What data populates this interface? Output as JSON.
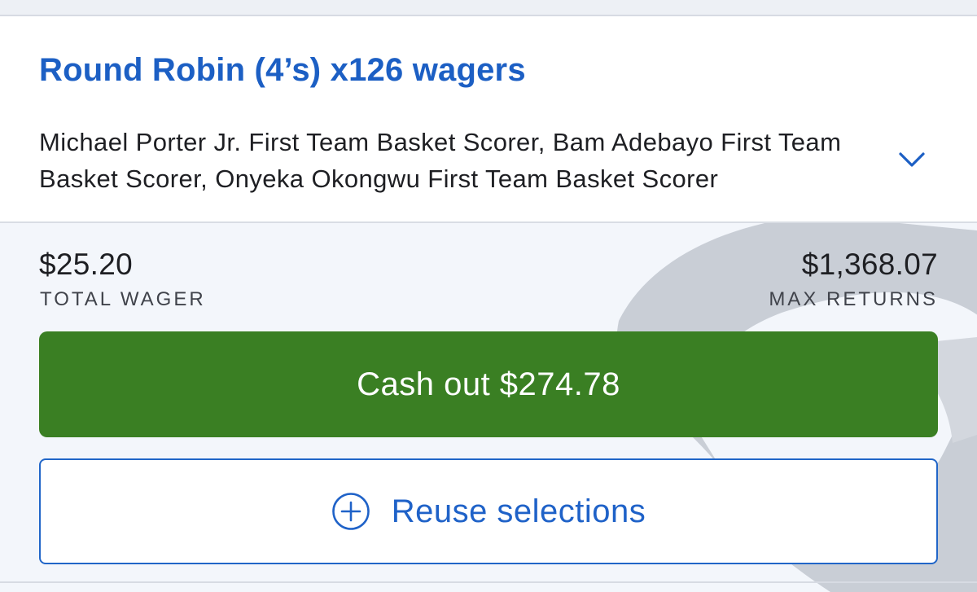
{
  "bet": {
    "title": "Round Robin (4’s) x126 wagers",
    "legs": "Michael Porter Jr. First Team Basket Scorer, Bam Adebayo First Team Basket Scorer, Onyeka Okongwu First Team Basket Scorer",
    "expand_icon": "chevron-down-icon"
  },
  "summary": {
    "total_wager_value": "$25.20",
    "total_wager_label": "TOTAL WAGER",
    "max_returns_value": "$1,368.07",
    "max_returns_label": "MAX RETURNS"
  },
  "actions": {
    "cashout_label": "Cash out $274.78",
    "reuse_label": "Reuse selections",
    "reuse_icon": "plus-circle-icon"
  },
  "colors": {
    "title_blue": "#1c5fc4",
    "cashout_green": "#3a7f23",
    "reuse_border": "#2166c8",
    "watermark": "#c9ced6"
  }
}
